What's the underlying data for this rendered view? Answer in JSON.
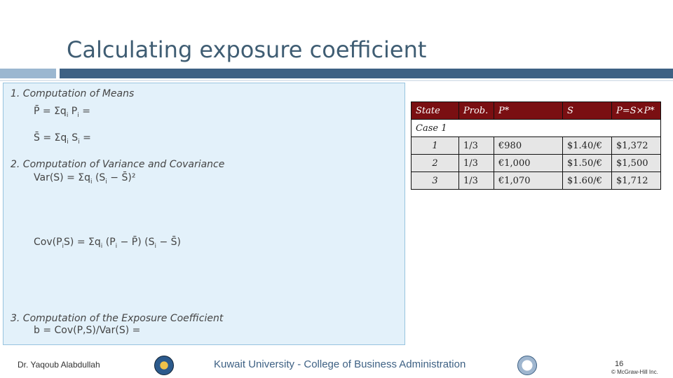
{
  "slide": {
    "title": "Calculating exposure coefficient",
    "lines": {
      "means_heading": "1. Computation of Means",
      "p_mean": "P̄ = Σq",
      "p_mean_sub1": "i",
      "p_mean_tail": " P",
      "p_mean_sub2": "i",
      "p_mean_end": " =",
      "s_mean": "S̄ = Σq",
      "s_mean_sub1": "i",
      "s_mean_tail": " S",
      "s_mean_sub2": "i",
      "s_mean_end": " =",
      "var_heading": "2. Computation of Variance and Covariance",
      "var_formula": "Var(S) = Σq",
      "var_sub1": "i",
      "var_tail": " (S",
      "var_sub2": "i",
      "var_end": " − S̄)² ",
      "cov_formula": "Cov(P",
      "cov_sub1": "i",
      "cov_mid": "S) = Σq",
      "cov_sub2": "i",
      "cov_mid2": " (P",
      "cov_sub3": "i",
      "cov_mid3": " − P̄) (S",
      "cov_sub4": "i",
      "cov_end": " − S̄)",
      "exposure_heading": "3. Computation of the Exposure Coefficient",
      "exposure_formula": "b = Cov(P,S)/Var(S) ="
    },
    "table": {
      "headers": [
        "State",
        "Prob.",
        "P*",
        "S",
        "P=S×P*"
      ],
      "case_label": "Case 1",
      "rows": [
        [
          "1",
          "1/3",
          "€980",
          "$1.40/€",
          "$1,372"
        ],
        [
          "2",
          "1/3",
          "€1,000",
          "$1.50/€",
          "$1,500"
        ],
        [
          "3",
          "1/3",
          "€1,070",
          "$1.60/€",
          "$1,712"
        ]
      ]
    }
  },
  "footer": {
    "author": "Dr. Yaqoub Alabdullah",
    "institution": "Kuwait University - College of Business Administration",
    "page_number": "16",
    "copyright": "© McGraw-Hill Inc."
  }
}
